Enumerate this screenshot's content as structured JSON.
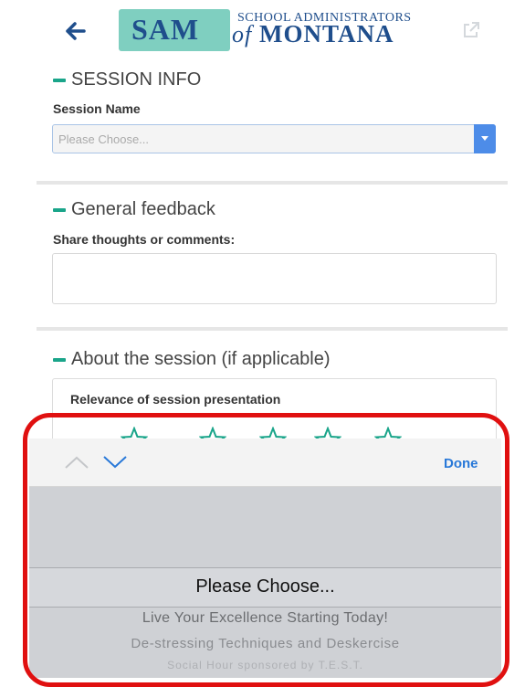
{
  "header": {
    "logo": {
      "sam": "SAM",
      "line1": "SCHOOL ADMINISTRATORS",
      "line2_of": "of",
      "line2": "MONTANA"
    },
    "back_icon": "arrow-left-icon",
    "share_icon": "external-link-icon"
  },
  "session_info": {
    "title": "SESSION INFO",
    "field_label": "Session Name",
    "placeholder": "Please Choose..."
  },
  "general_feedback": {
    "title": "General feedback",
    "field_label": "Share thoughts or comments:",
    "value": ""
  },
  "about_session": {
    "title": "About the session (if applicable)",
    "rating_label": "Relevance of session presentation",
    "stars": 5
  },
  "picker": {
    "done_label": "Done",
    "selected": "Please Choose...",
    "options": [
      "Live Your Excellence Starting Today!",
      "De-stressing Techniques and Deskercise",
      "Social Hour sponsored by T.E.S.T."
    ]
  },
  "colors": {
    "accent": "#1aa58a",
    "link": "#2878d8",
    "highlight": "#e01010",
    "brand": "#1f4e8c"
  }
}
